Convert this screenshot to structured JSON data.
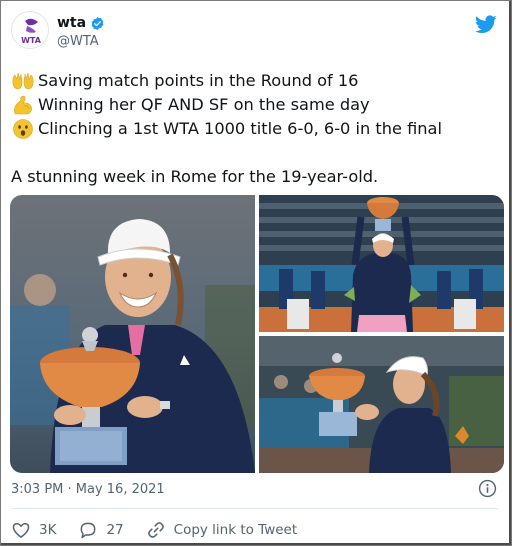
{
  "tweet": {
    "author_name": "wta",
    "handle": "@WTA",
    "avatar_text": "WTA",
    "lines": [
      {
        "emoji": "raised-hands-icon",
        "text": "Saving match points in the Round of 16"
      },
      {
        "emoji": "flexed-biceps-icon",
        "text": "Winning her QF AND SF on the same day"
      },
      {
        "emoji": "surprised-face-icon",
        "text": "Clinching a 1st WTA 1000 title 6-0, 6-0 in the final"
      }
    ],
    "closing_line": "A stunning week in Rome for the 19-year-old.",
    "timestamp": "3:03 PM · May 16, 2021"
  },
  "actions": {
    "likes": "3K",
    "replies": "27",
    "copy_link": "Copy link to Tweet"
  },
  "colors": {
    "twitter_blue": "#1d9bf0",
    "verified": "#1d9bf0",
    "avatar_brand": "#6b2fa3",
    "secondary_text": "#536471"
  },
  "icons": {
    "bird": "twitter-bird-icon",
    "verified": "verified-badge-icon",
    "info": "info-icon",
    "like": "heart-icon",
    "reply": "reply-bubble-icon",
    "link": "link-icon"
  }
}
